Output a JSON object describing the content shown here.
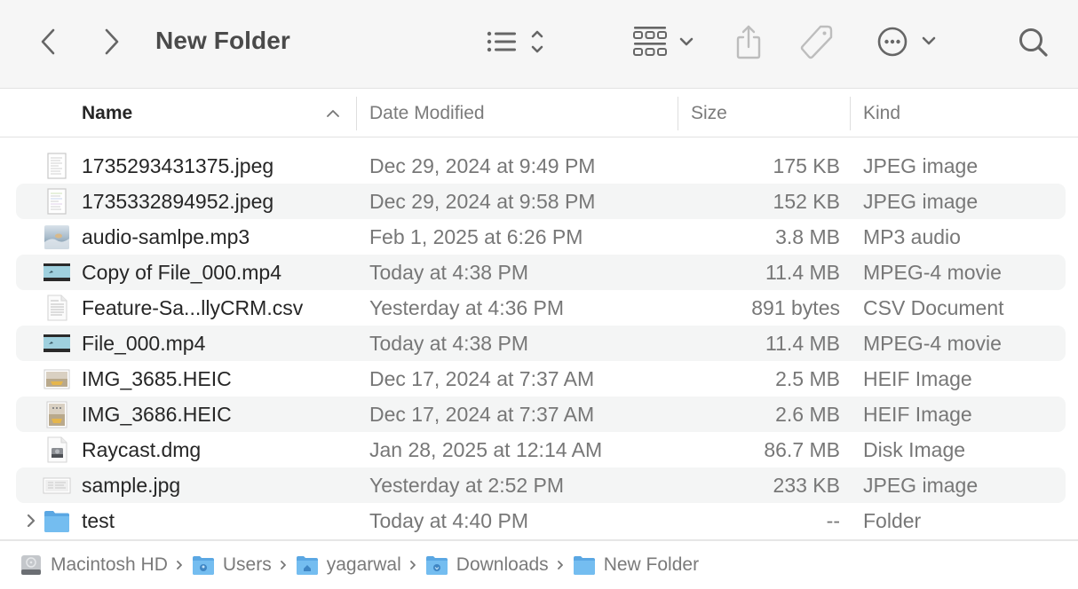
{
  "window": {
    "title": "New Folder"
  },
  "toolbar": {
    "back_icon": "chevron-left-icon",
    "forward_icon": "chevron-right-icon",
    "view_icon": "list-view-icon",
    "group_icon": "grid-group-icon",
    "share_icon": "share-icon",
    "tag_icon": "tag-icon",
    "more_icon": "ellipsis-circle-icon",
    "search_icon": "search-icon"
  },
  "columns": {
    "name": "Name",
    "date_modified": "Date Modified",
    "size": "Size",
    "kind": "Kind",
    "sort_indicator": "ascending"
  },
  "files": [
    {
      "name": "1735293431375.jpeg",
      "date": "Dec 29, 2024 at 9:49 PM",
      "size": "175 KB",
      "kind": "JPEG image",
      "icon": "document-thumbnail-icon"
    },
    {
      "name": "1735332894952.jpeg",
      "date": "Dec 29, 2024 at 9:58 PM",
      "size": "152 KB",
      "kind": "JPEG image",
      "icon": "document-thumbnail-icon"
    },
    {
      "name": "audio-samlpe.mp3",
      "date": "Feb 1, 2025 at 6:26 PM",
      "size": "3.8 MB",
      "kind": "MP3 audio",
      "icon": "audio-artwork-icon"
    },
    {
      "name": "Copy of File_000.mp4",
      "date": "Today at 4:38 PM",
      "size": "11.4 MB",
      "kind": "MPEG-4 movie",
      "icon": "video-thumbnail-icon"
    },
    {
      "name": "Feature-Sa...llyCRM.csv",
      "date": "Yesterday at 4:36 PM",
      "size": "891 bytes",
      "kind": "CSV Document",
      "icon": "csv-document-icon"
    },
    {
      "name": "File_000.mp4",
      "date": "Today at 4:38 PM",
      "size": "11.4 MB",
      "kind": "MPEG-4 movie",
      "icon": "video-thumbnail-icon"
    },
    {
      "name": "IMG_3685.HEIC",
      "date": "Dec 17, 2024 at 7:37 AM",
      "size": "2.5 MB",
      "kind": "HEIF Image",
      "icon": "photo-landscape-icon"
    },
    {
      "name": "IMG_3686.HEIC",
      "date": "Dec 17, 2024 at 7:37 AM",
      "size": "2.6 MB",
      "kind": "HEIF Image",
      "icon": "photo-portrait-icon"
    },
    {
      "name": "Raycast.dmg",
      "date": "Jan 28, 2025 at 12:14 AM",
      "size": "86.7 MB",
      "kind": "Disk Image",
      "icon": "disk-image-icon"
    },
    {
      "name": "sample.jpg",
      "date": "Yesterday at 2:52 PM",
      "size": "233 KB",
      "kind": "JPEG image",
      "icon": "image-thumbnail-icon"
    },
    {
      "name": "test",
      "date": "Today at 4:40 PM",
      "size": "--",
      "kind": "Folder",
      "icon": "folder-icon"
    }
  ],
  "pathbar": [
    {
      "label": "Macintosh HD",
      "icon": "hard-drive-icon"
    },
    {
      "label": "Users",
      "icon": "users-folder-icon"
    },
    {
      "label": "yagarwal",
      "icon": "home-folder-icon"
    },
    {
      "label": "Downloads",
      "icon": "downloads-folder-icon"
    },
    {
      "label": "New Folder",
      "icon": "folder-icon"
    }
  ],
  "colors": {
    "toolbar_bg": "#f6f6f6",
    "row_alt_bg": "#f4f5f5",
    "folder_blue": "#6cb6ec",
    "icon_gray": "#666666",
    "icon_disabled": "#bdbdbd"
  }
}
